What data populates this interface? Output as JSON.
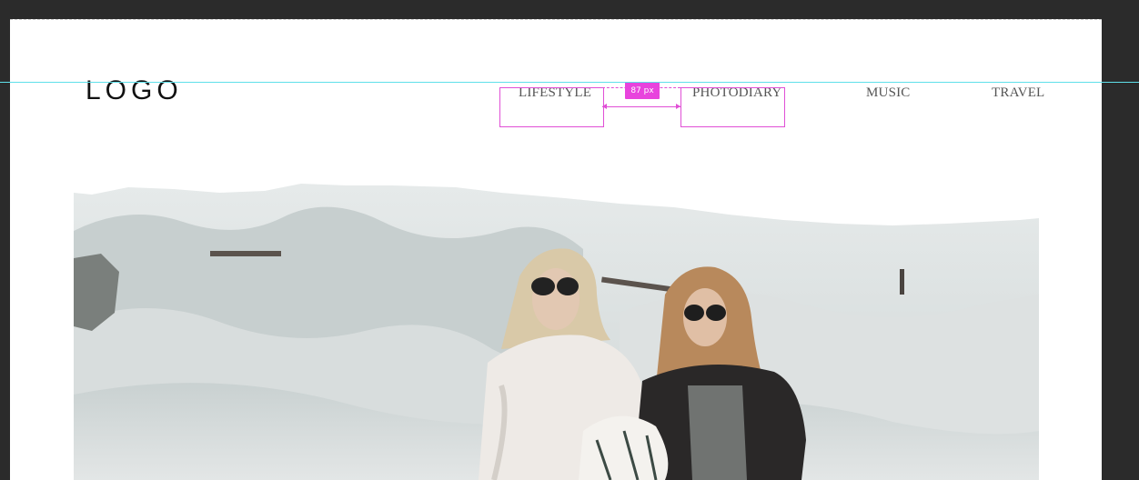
{
  "header": {
    "logo": "LOGO",
    "nav": [
      {
        "label": "LIFESTYLE"
      },
      {
        "label": "PHOTODIARY"
      },
      {
        "label": "MUSIC"
      },
      {
        "label": "TRAVEL"
      }
    ]
  },
  "editor": {
    "spacing_label": "87 px",
    "accent_color": "#e843dd",
    "guide_color": "#5fe0ea"
  },
  "hero": {
    "image_icon": "hero-photo"
  }
}
